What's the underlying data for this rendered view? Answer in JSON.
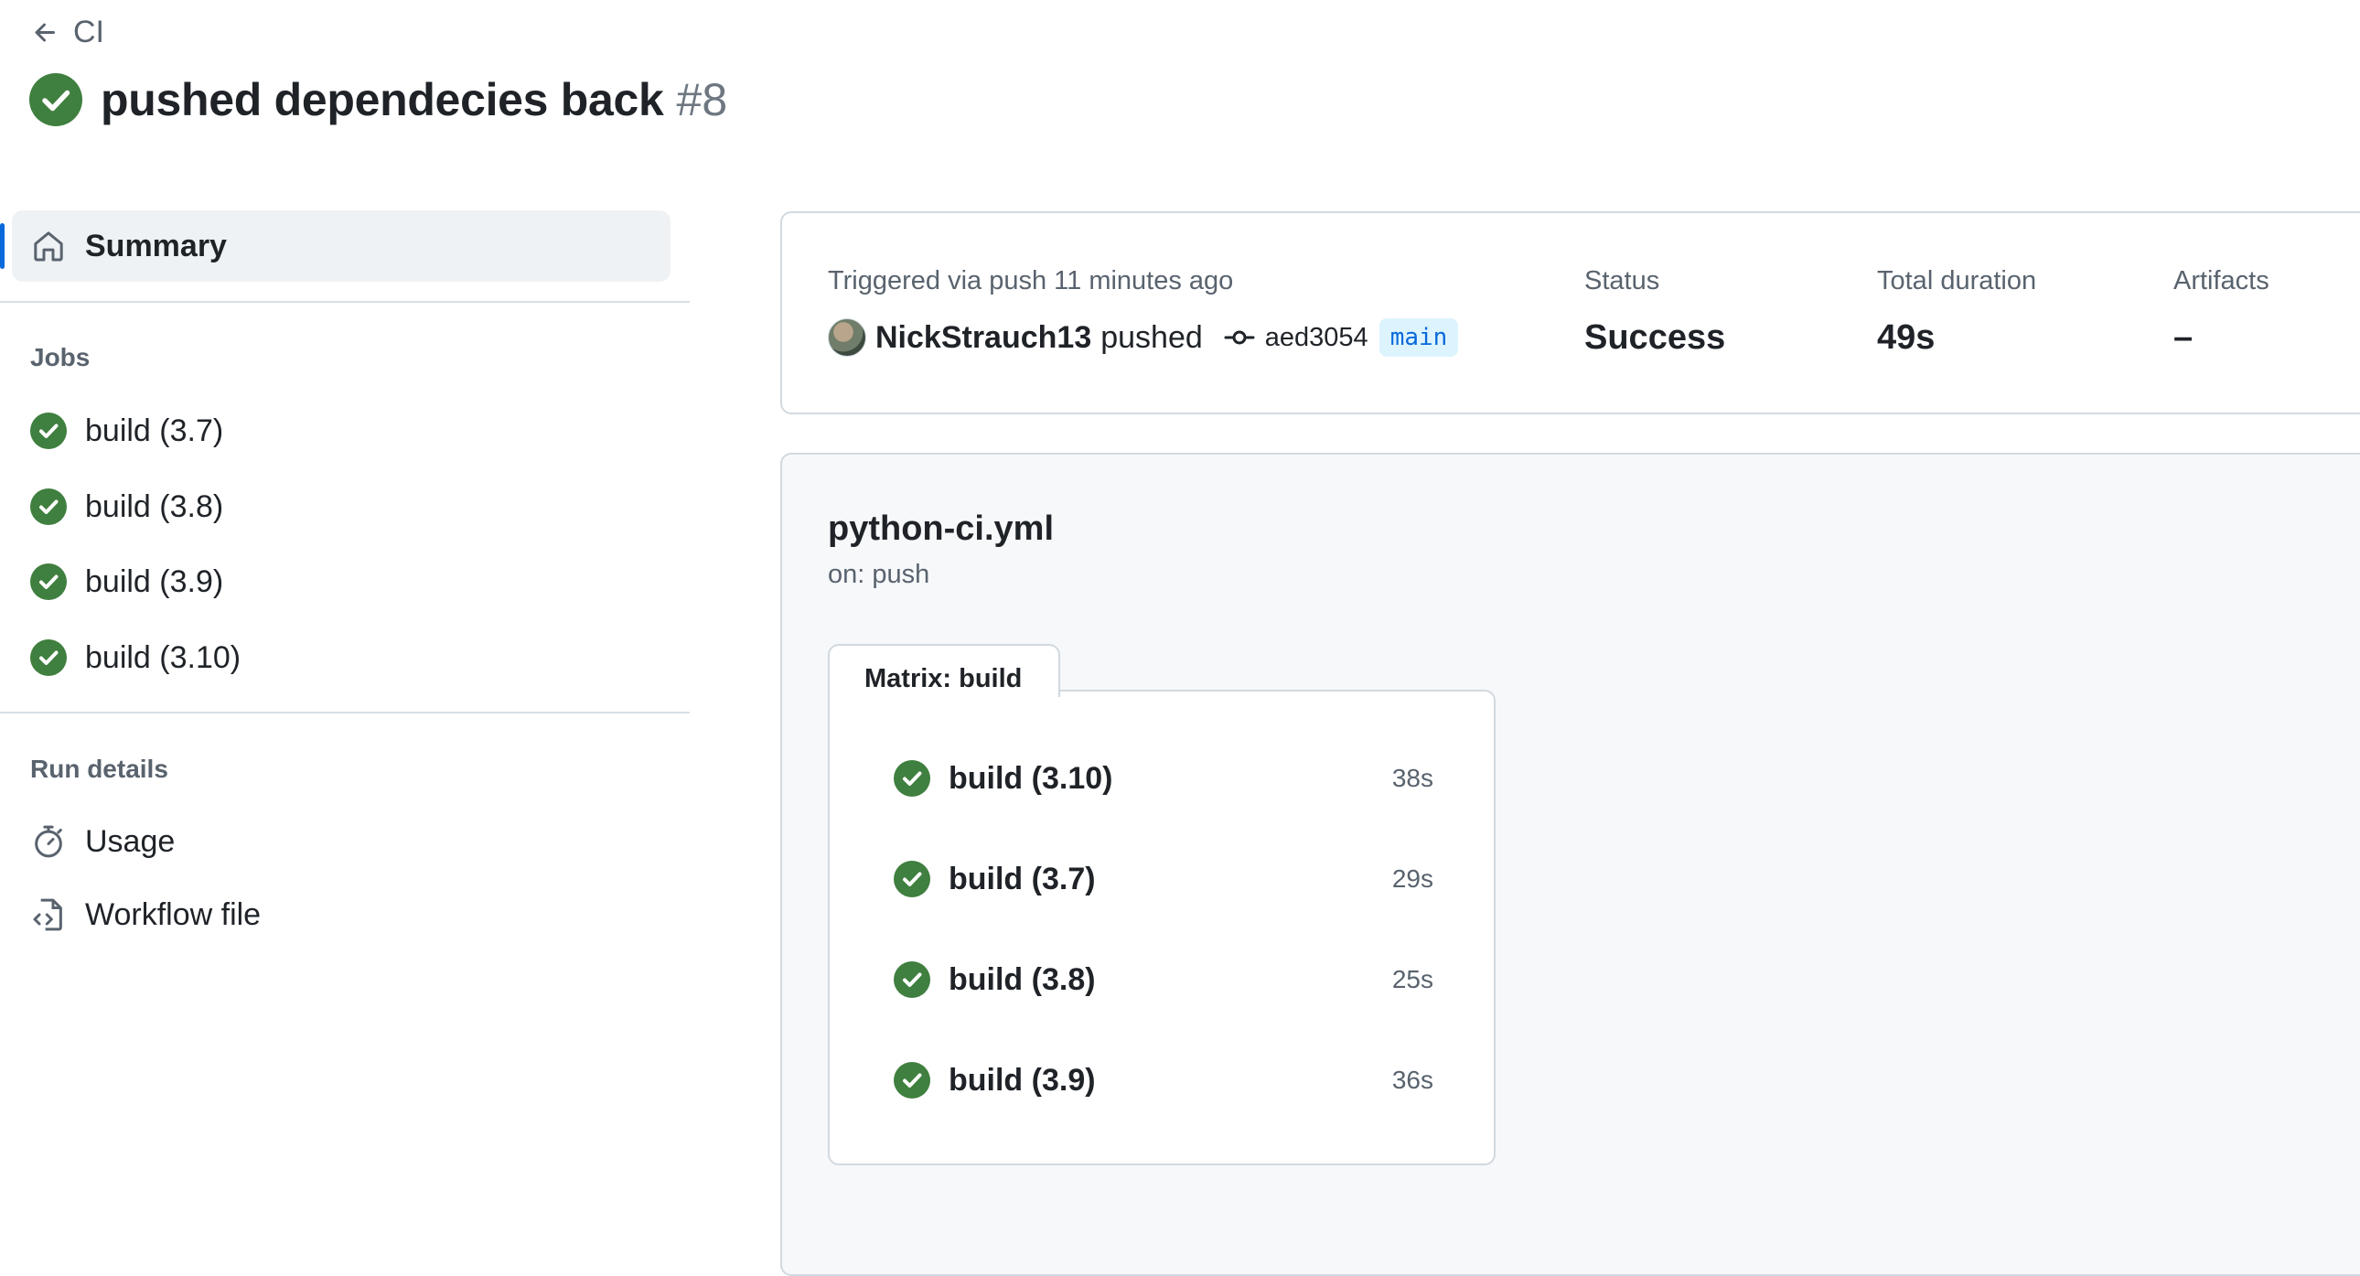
{
  "header": {
    "back_label": "CI",
    "title": "pushed dependecies back",
    "run_number": "#8"
  },
  "sidebar": {
    "summary_label": "Summary",
    "jobs_heading": "Jobs",
    "jobs": [
      {
        "label": "build (3.7)"
      },
      {
        "label": "build (3.8)"
      },
      {
        "label": "build (3.9)"
      },
      {
        "label": "build (3.10)"
      }
    ],
    "run_details_heading": "Run details",
    "usage_label": "Usage",
    "workflow_file_label": "Workflow file"
  },
  "summary": {
    "trigger_text": "Triggered via push 11 minutes ago",
    "user": "NickStrauch13",
    "action": "pushed",
    "commit_sha": "aed3054",
    "branch": "main",
    "status_label": "Status",
    "status_value": "Success",
    "duration_label": "Total duration",
    "duration_value": "49s",
    "artifacts_label": "Artifacts",
    "artifacts_value": "–"
  },
  "workflow": {
    "file_name": "python-ci.yml",
    "trigger": "on: push",
    "matrix_label": "Matrix: build",
    "jobs": [
      {
        "label": "build (3.10)",
        "duration": "38s"
      },
      {
        "label": "build (3.7)",
        "duration": "29s"
      },
      {
        "label": "build (3.8)",
        "duration": "25s"
      },
      {
        "label": "build (3.9)",
        "duration": "36s"
      }
    ]
  },
  "colors": {
    "success": "#3f7f3f",
    "accent": "#0969da",
    "border": "#d1d9e0",
    "muted_text": "#59636e"
  }
}
